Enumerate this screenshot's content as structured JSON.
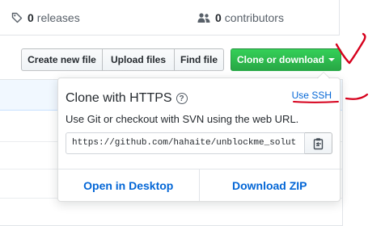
{
  "stats": {
    "releases": {
      "count": "0",
      "label": "releases",
      "icon": "tag-icon"
    },
    "contributors": {
      "count": "0",
      "label": "contributors",
      "icon": "people-icon"
    }
  },
  "toolbar": {
    "create_new_file": "Create new file",
    "upload_files": "Upload files",
    "find_file": "Find file",
    "clone_or_download": "Clone or download"
  },
  "clone_popover": {
    "title": "Clone with HTTPS",
    "help_glyph": "?",
    "use_ssh": "Use SSH",
    "description": "Use Git or checkout with SVN using the web URL.",
    "url": "https://github.com/hahaite/unblockme_solut",
    "open_in_desktop": "Open in Desktop",
    "download_zip": "Download ZIP"
  },
  "colors": {
    "primary_green": "#28a745",
    "link_blue": "#0366d6",
    "annotation_red": "#d6001c"
  }
}
